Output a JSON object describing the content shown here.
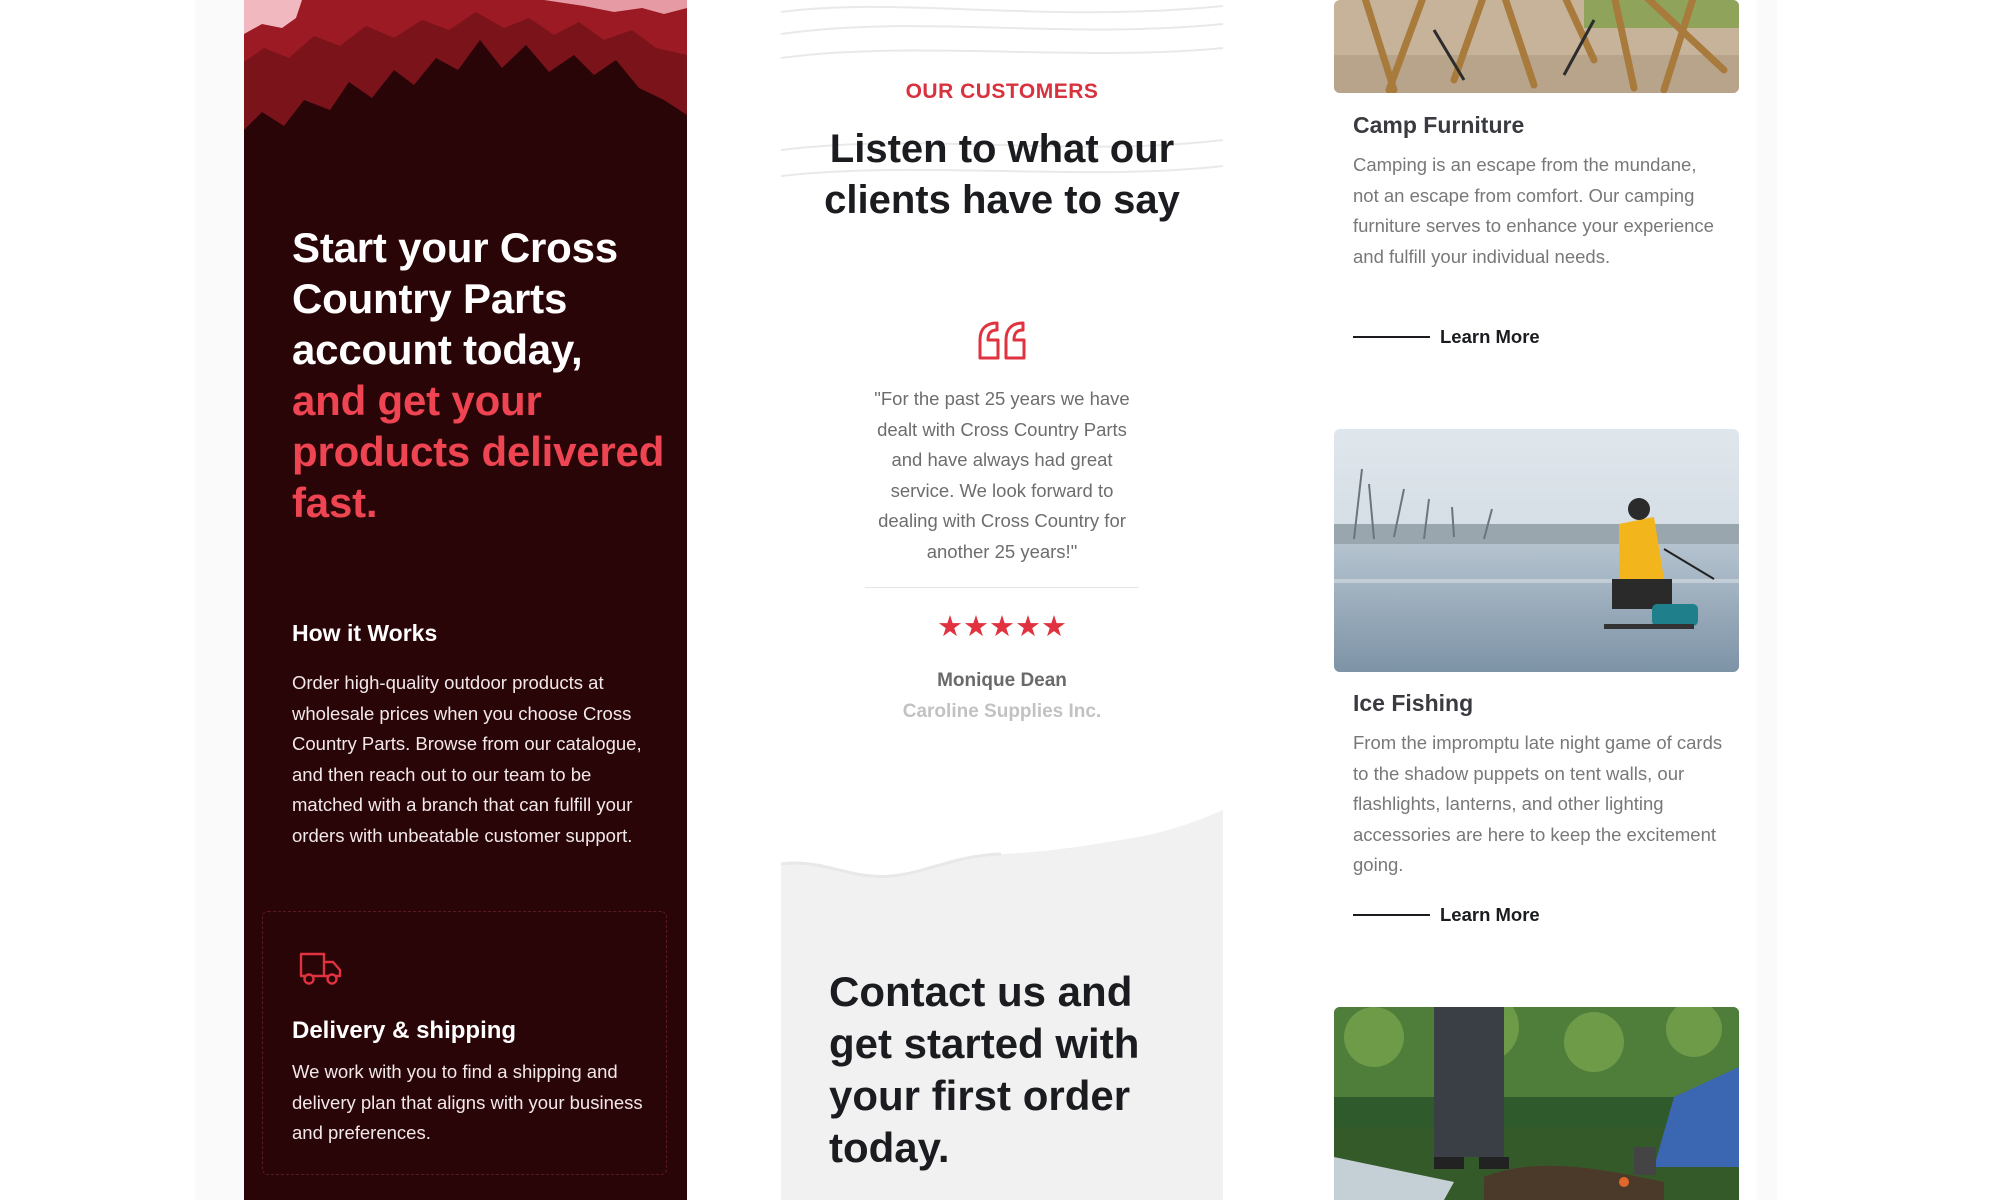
{
  "hero": {
    "headline_main": "Start your Cross Country Parts account today,",
    "headline_accent": "and get your products delivered fast.",
    "how_title": "How it Works",
    "how_body": "Order high-quality outdoor products at wholesale prices when you choose Cross Country Parts. Browse from our catalogue, and then reach out to our team to be matched with a branch that can fulfill your orders with unbeatable customer support.",
    "feature": {
      "icon": "truck-icon",
      "title": "Delivery & shipping",
      "body": "We work with you to find a shipping and delivery plan that aligns with your business and preferences."
    },
    "colors": {
      "background": "#2a0508",
      "accent": "#ef4451"
    }
  },
  "testimonials": {
    "eyebrow": "OUR CUSTOMERS",
    "title": "Listen to what our clients have to say",
    "quote": "\"For the past 25 years we have dealt with Cross Country Parts and have always had great service. We look forward to dealing with Cross Country for another 25 years!\"",
    "rating": 5,
    "stars": "★★★★★",
    "author": "Monique Dean",
    "company": "Caroline Supplies Inc.",
    "contact_heading": "Contact us and get started with your first order today."
  },
  "products": [
    {
      "title": "Camp Furniture",
      "description": "Camping is an escape from the mundane, not an escape from comfort. Our camping furniture serves to enhance your experience and fulfill your individual needs.",
      "link": "Learn More"
    },
    {
      "title": "Ice Fishing",
      "description": "From the impromptu late night game of cards to the shadow puppets on tent walls, our flashlights, lanterns, and other lighting accessories are here to keep the excitement going.",
      "link": "Learn More"
    }
  ]
}
